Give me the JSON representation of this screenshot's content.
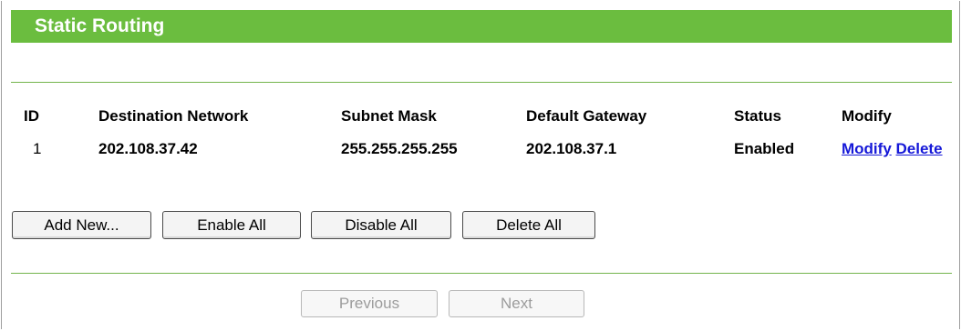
{
  "page": {
    "title": "Static Routing"
  },
  "table": {
    "headers": {
      "id": "ID",
      "destination": "Destination Network",
      "subnet": "Subnet Mask",
      "gateway": "Default Gateway",
      "status": "Status",
      "modify": "Modify"
    },
    "rows": [
      {
        "id": "1",
        "destination": "202.108.37.42",
        "subnet": "255.255.255.255",
        "gateway": "202.108.37.1",
        "status": "Enabled",
        "modify_link": "Modify",
        "delete_link": "Delete"
      }
    ]
  },
  "actions": {
    "add_new": "Add New...",
    "enable_all": "Enable All",
    "disable_all": "Disable All",
    "delete_all": "Delete All"
  },
  "pagination": {
    "previous": "Previous",
    "next": "Next"
  },
  "colors": {
    "title_bar": "#6bbd3f",
    "divider": "#73b44c",
    "link": "#1518d8"
  }
}
